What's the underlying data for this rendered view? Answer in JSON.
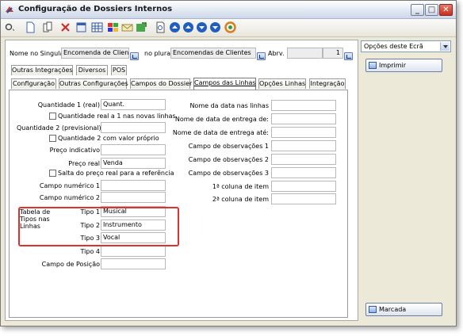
{
  "window": {
    "title": "Configuração de Dossiers Internos"
  },
  "toolbar": {
    "icons": [
      "tools-icon",
      "new-doc-icon",
      "copy-doc-icon",
      "delete-icon",
      "properties-icon",
      "grid-icon",
      "colors-icon",
      "mail-icon",
      "export-icon",
      "print-preview-icon",
      "nav-first-icon",
      "nav-prev-icon",
      "nav-next-icon",
      "nav-last-icon",
      "refresh-icon"
    ]
  },
  "header": {
    "singular_label": "Nome no Singular",
    "singular_value": "Encomenda de Cliente",
    "plural_label": "no plural",
    "plural_value": "Encomendas de Clientes",
    "abrv_label": "Abrv.",
    "abrv_value": "",
    "number_value": "1"
  },
  "tabs_row1": [
    "Outras Integrações",
    "Diversos",
    "POS"
  ],
  "tabs_row2": [
    "Configuração",
    "Outras Configurações",
    "Campos do Dossier",
    "Campos das Linhas",
    "Opções Linhas",
    "Integração"
  ],
  "form": {
    "qtd1_label": "Quantidade 1 (real)",
    "qtd1_value": "Quant.",
    "qtd_real_cb": "Quantidade real a 1 nas novas linhas",
    "qtd2_label": "Quantidade 2 (previsional)",
    "qtd2_value": "",
    "qtd2_cb": "Quantidade 2 com valor próprio",
    "preco_ind_label": "Preço indicativo",
    "preco_ind_value": "",
    "preco_real_label": "Preço real",
    "preco_real_value": "Venda",
    "salta_cb": "Salta do preço real para a referência",
    "campo_num1_label": "Campo numérico 1",
    "campo_num1_value": "",
    "campo_num2_label": "Campo numérico 2",
    "campo_num2_value": "",
    "tabela_label": "Tabela de Tipos nas Linhas",
    "tipo1_label": "Tipo 1",
    "tipo1_value": "Musical",
    "tipo2_label": "Tipo 2",
    "tipo2_value": "Instrumento",
    "tipo3_label": "Tipo 3",
    "tipo3_value": "Vocal",
    "tipo4_label": "Tipo 4",
    "tipo4_value": "",
    "posicao_label": "Campo de Posição",
    "posicao_value": "",
    "right": [
      {
        "label": "Nome da data nas linhas",
        "value": ""
      },
      {
        "label": "Nome de data de entrega de:",
        "value": ""
      },
      {
        "label": "Nome de data de entrega até:",
        "value": ""
      },
      {
        "label": "Campo de observações 1",
        "value": ""
      },
      {
        "label": "Campo de observações 2",
        "value": ""
      },
      {
        "label": "Campo de observações 3",
        "value": ""
      },
      {
        "label": "1ª coluna de item",
        "value": ""
      },
      {
        "label": "2ª coluna de item",
        "value": ""
      }
    ]
  },
  "side": {
    "options_label": "Opções deste Ecrã",
    "print_label": "Imprimir",
    "marcada_label": "Marcada"
  }
}
